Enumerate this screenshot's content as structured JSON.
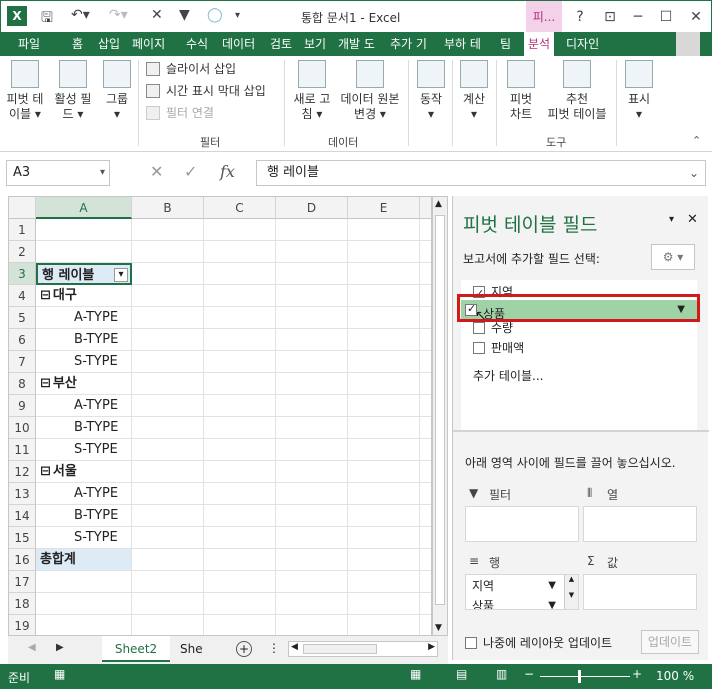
{
  "window": {
    "title": "통합 문서1 - Excel",
    "context_tab": "피...",
    "help_button": "?"
  },
  "tabs": {
    "file": "파일",
    "items": [
      "홈",
      "삽입",
      "페이지",
      "수식",
      "데이터",
      "검토",
      "보기",
      "개발 도",
      "추가 기",
      "부하 테",
      "팀"
    ],
    "analyze": "분석",
    "design": "디자인"
  },
  "ribbon": {
    "pivot_table": "피벗 테\n이블 ▾",
    "active_field": "활성 필\n드 ▾",
    "group": "그룹\n▾",
    "slicer": "슬라이서 삽입",
    "timeline": "시간 표시 막대 삽입",
    "filter_connections": "필터 연결",
    "filter_group": "필터",
    "refresh": "새로 고\n침 ▾",
    "change_source": "데이터 원본\n변경 ▾",
    "data_group": "데이터",
    "actions": "동작\n▾",
    "calculations": "계산\n▾",
    "pivot_chart": "피벗\n차트",
    "recommended_pivot": "추천\n피벗 테이블",
    "tools_group": "도구",
    "show": "표시\n▾"
  },
  "formula_bar": {
    "name_box": "A3",
    "value": "행 레이블"
  },
  "sheet": {
    "columns": [
      "A",
      "B",
      "C",
      "D",
      "E"
    ],
    "rows": [
      "1",
      "2",
      "3",
      "4",
      "5",
      "6",
      "7",
      "8",
      "9",
      "10",
      "11",
      "12",
      "13",
      "14",
      "15",
      "16",
      "17",
      "18",
      "19"
    ],
    "cells": {
      "A3": "행 레이블",
      "A4": "대구",
      "A5": "A-TYPE",
      "A6": "B-TYPE",
      "A7": "S-TYPE",
      "A8": "부산",
      "A9": "A-TYPE",
      "A10": "B-TYPE",
      "A11": "S-TYPE",
      "A12": "서울",
      "A13": "A-TYPE",
      "A14": "B-TYPE",
      "A15": "S-TYPE",
      "A16": "총합계"
    },
    "tabs": [
      "Sheet2",
      "She"
    ],
    "active_tab": "Sheet2"
  },
  "status": {
    "ready": "준비",
    "zoom": "100 %"
  },
  "pivot_pane": {
    "title": "피벗 테이블 필드",
    "choose_label": "보고서에 추가할 필드 선택:",
    "fields": [
      {
        "name": "지역",
        "checked": true
      },
      {
        "name": "상품",
        "checked": true
      },
      {
        "name": "수량",
        "checked": false
      },
      {
        "name": "판매액",
        "checked": false
      }
    ],
    "more_tables": "추가 테이블...",
    "drag_hint": "아래 영역 사이에 필드를 끌어 놓으십시오.",
    "filters_label": "필터",
    "columns_label": "열",
    "rows_label": "행",
    "values_label": "값",
    "row_items": [
      "지역",
      "상품"
    ],
    "defer_label": "나중에 레이아웃 업데이트",
    "update_button": "업데이트"
  },
  "colors": {
    "excel_green": "#207245",
    "highlight_box": "#d11a1a",
    "selected_field": "#9fd3a6"
  }
}
